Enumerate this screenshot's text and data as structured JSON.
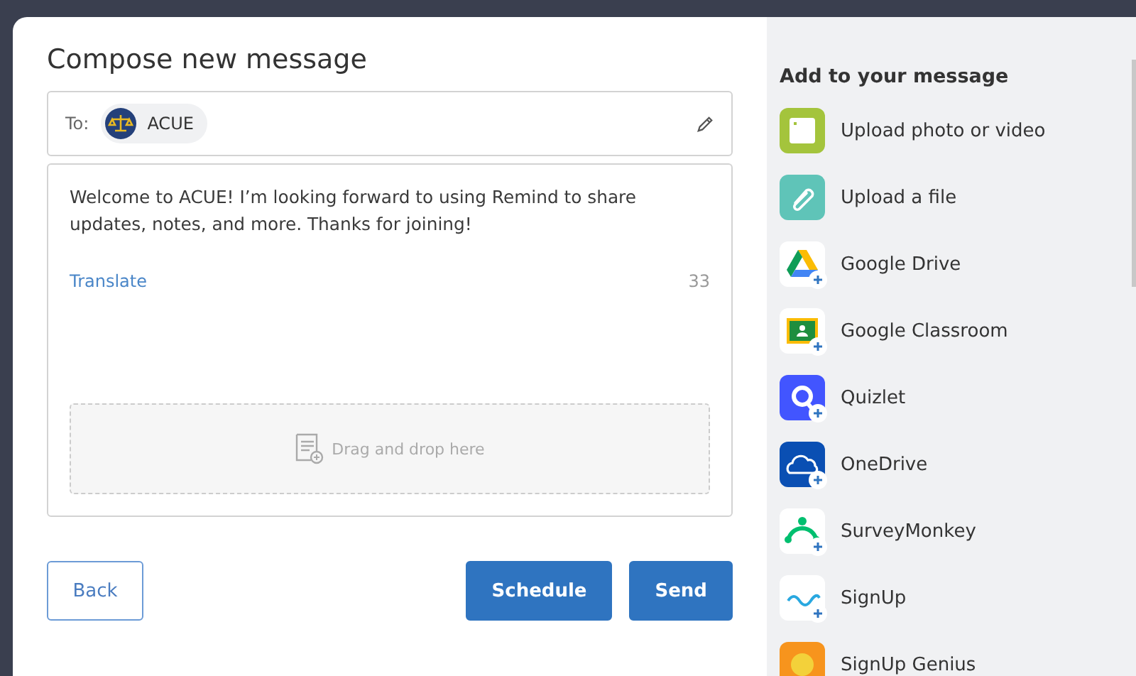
{
  "compose": {
    "title": "Compose new message",
    "to_label": "To:",
    "recipient": {
      "name": "ACUE"
    },
    "message": "Welcome to ACUE! I’m looking forward to using Remind to share updates, notes, and more. Thanks for joining!",
    "translate_link": "Translate",
    "char_count": "33",
    "drop_zone": "Drag and drop here"
  },
  "buttons": [
    {
      "label": "Back",
      "kind": "outline"
    },
    {
      "label": "Schedule",
      "kind": "primary"
    },
    {
      "label": "Send",
      "kind": "primary"
    }
  ],
  "attachments": {
    "heading": "Add to your message",
    "items": [
      {
        "label": "Upload photo or video",
        "kind": "photo",
        "addable": false
      },
      {
        "label": "Upload a file",
        "kind": "file",
        "addable": false
      },
      {
        "label": "Google Drive",
        "kind": "drive",
        "addable": true
      },
      {
        "label": "Google Classroom",
        "kind": "classroom",
        "addable": true
      },
      {
        "label": "Quizlet",
        "kind": "quizlet",
        "addable": true
      },
      {
        "label": "OneDrive",
        "kind": "onedrive",
        "addable": true
      },
      {
        "label": "SurveyMonkey",
        "kind": "surveymonkey",
        "addable": true
      },
      {
        "label": "SignUp",
        "kind": "signup",
        "addable": true
      },
      {
        "label": "SignUp Genius",
        "kind": "genius",
        "addable": false
      }
    ]
  }
}
